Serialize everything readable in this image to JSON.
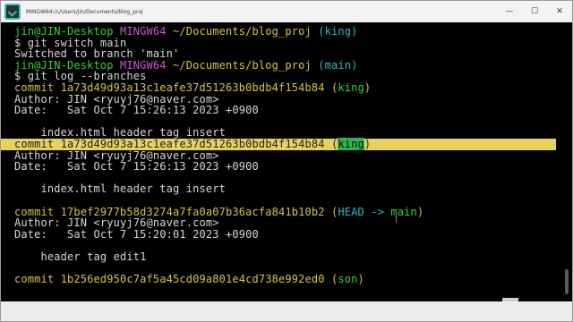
{
  "window": {
    "title": "MINGW64:/c/Users/jin/Documents/blog_proj",
    "minimize_glyph": "—",
    "maximize_glyph": "☐",
    "close_glyph": "✕"
  },
  "terminal": {
    "prompt1": {
      "user": "jin@JIN-Desktop",
      "shell": "MINGW64",
      "path": "~/Documents/blog_proj",
      "branch": "(king)"
    },
    "cmd1": "$ git switch main",
    "out1": "Switched to branch 'main'",
    "prompt2": {
      "user": "jin@JIN-Desktop",
      "shell": "MINGW64",
      "path": "~/Documents/blog_proj",
      "branch": "(main)"
    },
    "cmd2": "$ git log --branches",
    "commits": [
      {
        "commit_label": "commit 1a73d49d93a13c1eafe37d51263b0bdb4f154b84",
        "ref_open": " (",
        "ref": "king",
        "ref_close": ")",
        "author": "Author: JIN <ryuyj76@naver.com>",
        "date": "Date:   Sat Oct 7 15:26:13 2023 +0900",
        "message": "    index.html header tag insert"
      },
      {
        "commit_label": "commit 1a73d49d93a13c1eafe37d51263b0bdb4f154b84",
        "ref_open": " (",
        "ref": "king",
        "ref_close": ")",
        "author": "Author: JIN <ryuyj76@naver.com>",
        "date": "Date:   Sat Oct 7 15:26:13 2023 +0900",
        "message": "    index.html header tag insert"
      },
      {
        "commit_label": "commit 17bef2977b58d3274a7fa0a07b36acfa841b10b2",
        "ref_open": " (",
        "ref_head": "HEAD -> ",
        "ref": "main",
        "ref_close": ")",
        "author": "Author: JIN <ryuyj76@naver.com>",
        "date": "Date:   Sat Oct 7 15:20:01 2023 +0900",
        "message": "    header tag edit1"
      },
      {
        "commit_label": "commit 1b256ed950c7af5a45cd09a801e4cd738e992ed0",
        "ref_open": " (",
        "ref": "son",
        "ref_close": ")"
      }
    ]
  },
  "colors": {
    "background": "#000000",
    "user_host": "#36d13a",
    "shell": "#cf53cf",
    "path": "#d6c43c",
    "branch": "#2fb8c8",
    "commit": "#d6c43c",
    "highlight": "#e7d25f",
    "ref_highlight": "#2db34a"
  }
}
